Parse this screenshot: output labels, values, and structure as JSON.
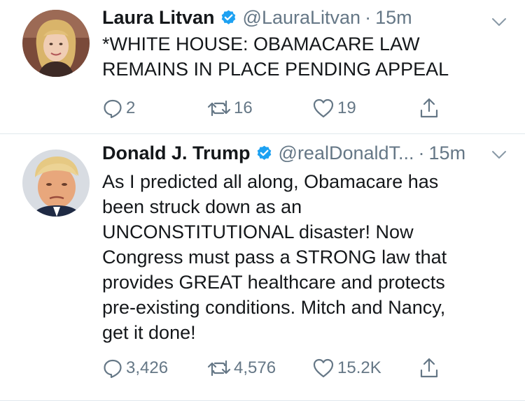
{
  "tweets": [
    {
      "author": "Laura Litvan",
      "handle": "@LauraLitvan",
      "separator": "·",
      "time": "15m",
      "verified": true,
      "lines": [
        "*WHITE HOUSE: OBAMACARE LAW",
        "REMAINS IN PLACE PENDING APPEAL"
      ],
      "replies": "2",
      "retweets": "16",
      "likes": "19"
    },
    {
      "author": "Donald J. Trump",
      "handle": "@realDonaldT...",
      "separator": "·",
      "time": "15m",
      "verified": true,
      "lines": [
        "As I predicted all along, Obamacare has",
        "been struck down as an",
        "UNCONSTITUTIONAL disaster! Now",
        "Congress must pass a STRONG law that",
        "provides GREAT healthcare and protects",
        "pre-existing conditions. Mitch and Nancy,",
        "get it done!"
      ],
      "replies": "3,426",
      "retweets": "4,576",
      "likes": "15.2K"
    }
  ],
  "icons": {
    "verified": "verified-badge-icon",
    "reply": "reply-icon",
    "retweet": "retweet-icon",
    "like": "heart-icon",
    "share": "share-icon",
    "menu": "chevron-down-icon"
  },
  "colors": {
    "text": "#14171a",
    "secondary": "#657786",
    "verified": "#1da1f2",
    "divider": "#e1e8ed"
  }
}
